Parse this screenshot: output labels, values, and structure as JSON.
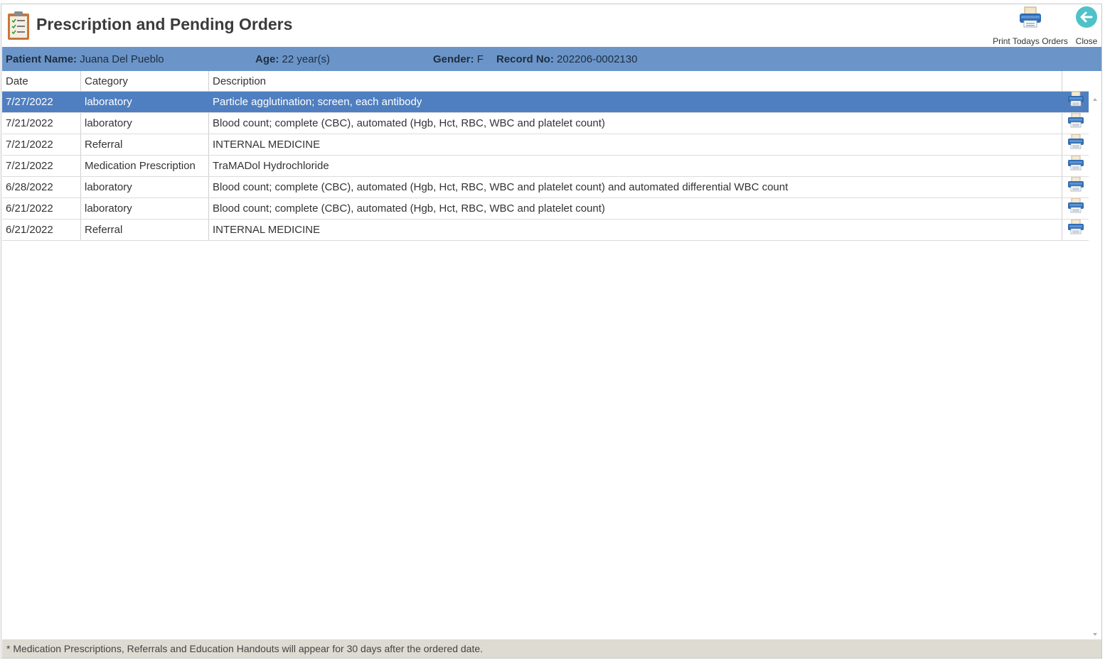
{
  "window": {
    "title": "Prescription and Pending Orders",
    "app_icon": "clipboard-checklist-icon"
  },
  "toolbar": {
    "print_label": "Print Todays Orders",
    "print_icon": "printer-icon",
    "close_label": "Close",
    "close_icon": "arrow-left-circle-icon"
  },
  "patient": {
    "name_label": "Patient Name:",
    "name_value": "Juana Del Pueblo",
    "age_label": "Age:",
    "age_value": "22 year(s)",
    "gender_label": "Gender:",
    "gender_value": "F",
    "record_label": "Record No:",
    "record_value": "202206-0002130"
  },
  "grid": {
    "columns": [
      "Date",
      "Category",
      "Description",
      ""
    ],
    "rows": [
      {
        "date": "7/27/2022",
        "category": "laboratory",
        "description": "Particle agglutination; screen, each antibody",
        "selected": true
      },
      {
        "date": "7/21/2022",
        "category": "laboratory",
        "description": "Blood count; complete (CBC), automated (Hgb, Hct, RBC, WBC and platelet count)",
        "selected": false
      },
      {
        "date": "7/21/2022",
        "category": "Referral",
        "description": "INTERNAL MEDICINE",
        "selected": false
      },
      {
        "date": "7/21/2022",
        "category": "Medication Prescription",
        "description": "TraMADol Hydrochloride",
        "selected": false
      },
      {
        "date": "6/28/2022",
        "category": "laboratory",
        "description": "Blood count; complete (CBC), automated (Hgb, Hct, RBC, WBC and platelet count) and automated differential WBC count",
        "selected": false
      },
      {
        "date": "6/21/2022",
        "category": "laboratory",
        "description": "Blood count; complete (CBC), automated (Hgb, Hct, RBC, WBC and platelet count)",
        "selected": false
      },
      {
        "date": "6/21/2022",
        "category": "Referral",
        "description": "INTERNAL MEDICINE",
        "selected": false
      }
    ]
  },
  "footer": {
    "note": "* Medication Prescriptions, Referrals and Education Handouts will appear for 30 days after the ordered date."
  },
  "colors": {
    "patient_bar": "#6b95c8",
    "selected_row": "#4f7fc0",
    "footer": "#dedbd2",
    "close_button": "#4fc1c9"
  }
}
